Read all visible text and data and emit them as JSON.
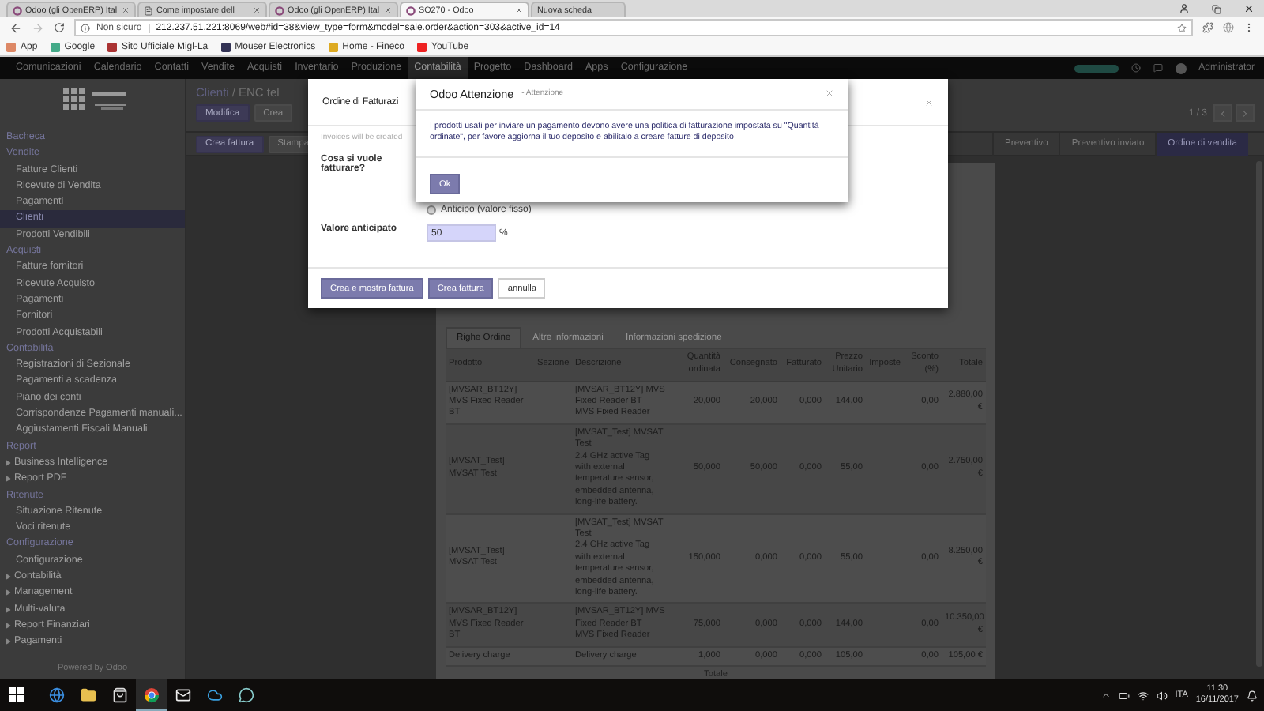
{
  "browser": {
    "tabs": [
      {
        "title": "Odoo (gli OpenERP) Ital",
        "kind": "site",
        "selected": false
      },
      {
        "title": "Come impostare dell",
        "kind": "document",
        "selected": false
      },
      {
        "title": "Odoo (gli OpenERP) Ital",
        "kind": "site",
        "selected": false
      },
      {
        "title": "SO270 - Odoo",
        "kind": "site",
        "selected": true
      },
      {
        "title": "Nuova scheda",
        "kind": "blank",
        "selected": false
      }
    ],
    "security": "Non sicuro",
    "url": "212.237.51.221:8069/web#id=38&view_type=form&model=sale.order&action=303&active_id=14",
    "bookmarks": [
      "App",
      "Google",
      "Sito Ufficiale Migl-La",
      "Mouser Electronics",
      "Home - Fineco",
      "YouTube"
    ]
  },
  "top_nav": {
    "items": [
      {
        "label": "Comunicazioni",
        "selected": false
      },
      {
        "label": "Calendario",
        "selected": false
      },
      {
        "label": "Contatti",
        "selected": false
      },
      {
        "label": "Vendite",
        "selected": false
      },
      {
        "label": "Acquisti",
        "selected": false
      },
      {
        "label": "Inventario",
        "selected": false
      },
      {
        "label": "Produzione",
        "selected": false
      },
      {
        "label": "Contabilità",
        "selected": true
      },
      {
        "label": "Progetto",
        "selected": false
      },
      {
        "label": "Dashboard",
        "selected": false
      },
      {
        "label": "Apps",
        "selected": false
      },
      {
        "label": "Configurazione",
        "selected": false
      }
    ],
    "user": "Administrator"
  },
  "sidebar": {
    "items": [
      {
        "label": "Bacheca",
        "kind": "header",
        "selected": false
      },
      {
        "label": "Vendite",
        "kind": "header",
        "selected": false
      },
      {
        "label": "Fatture Clienti",
        "kind": "link",
        "selected": false
      },
      {
        "label": "Ricevute di Vendita",
        "kind": "link",
        "selected": false
      },
      {
        "label": "Pagamenti",
        "kind": "link",
        "selected": false
      },
      {
        "label": "Clienti",
        "kind": "link",
        "selected": true
      },
      {
        "label": "Prodotti Vendibili",
        "kind": "link",
        "selected": false
      },
      {
        "label": "Acquisti",
        "kind": "header",
        "selected": false
      },
      {
        "label": "Fatture fornitori",
        "kind": "link",
        "selected": false
      },
      {
        "label": "Ricevute Acquisto",
        "kind": "link",
        "selected": false
      },
      {
        "label": "Pagamenti",
        "kind": "link",
        "selected": false
      },
      {
        "label": "Fornitori",
        "kind": "link",
        "selected": false
      },
      {
        "label": "Prodotti Acquistabili",
        "kind": "link",
        "selected": false
      },
      {
        "label": "Contabilità",
        "kind": "header",
        "selected": false
      },
      {
        "label": "Registrazioni di Sezionale",
        "kind": "link",
        "selected": false
      },
      {
        "label": "Pagamenti a scadenza",
        "kind": "link",
        "selected": false
      },
      {
        "label": "Piano dei conti",
        "kind": "link",
        "selected": false
      },
      {
        "label": "Corrispondenze Pagamenti manuali...",
        "kind": "link",
        "selected": false
      },
      {
        "label": "Aggiustamenti Fiscali Manuali",
        "kind": "link",
        "selected": false
      },
      {
        "label": "Report",
        "kind": "header",
        "selected": false
      },
      {
        "label": "Business Intelligence",
        "kind": "folder",
        "selected": false
      },
      {
        "label": "Report PDF",
        "kind": "folder",
        "selected": false
      },
      {
        "label": "Ritenute",
        "kind": "header",
        "selected": false
      },
      {
        "label": "Situazione Ritenute",
        "kind": "link",
        "selected": false
      },
      {
        "label": "Voci ritenute",
        "kind": "link",
        "selected": false
      },
      {
        "label": "Configurazione",
        "kind": "header",
        "selected": false
      },
      {
        "label": "Configurazione",
        "kind": "link",
        "selected": false
      },
      {
        "label": "Contabilità",
        "kind": "folder",
        "selected": false
      },
      {
        "label": "Management",
        "kind": "folder",
        "selected": false
      },
      {
        "label": "Multi-valuta",
        "kind": "folder",
        "selected": false
      },
      {
        "label": "Report Finanziari",
        "kind": "folder",
        "selected": false
      },
      {
        "label": "Pagamenti",
        "kind": "folder",
        "selected": false
      }
    ],
    "footer": "Powered by Odoo"
  },
  "breadcrumb": {
    "items": [
      "Clienti",
      "ENC tel"
    ],
    "separator": "/"
  },
  "actions": [
    "Modifica",
    "Crea"
  ],
  "pager": "1 / 3",
  "header_buttons": [
    "Crea fattura",
    "Stampa"
  ],
  "stages": [
    {
      "label": "Preventivo",
      "selected": false
    },
    {
      "label": "Preventivo inviato",
      "selected": false
    },
    {
      "label": "Ordine di vendita",
      "selected": true
    }
  ],
  "notebook": {
    "tabs": [
      {
        "label": "Righe Ordine",
        "selected": true
      },
      {
        "label": "Altre informazioni",
        "selected": false
      },
      {
        "label": "Informazioni spedizione",
        "selected": false
      }
    ],
    "columns": [
      "Prodotto",
      "Sezione",
      "Descrizione",
      "Quantità ordinata",
      "Consegnato",
      "Fatturato",
      "Prezzo Unitario",
      "Imposte",
      "Sconto (%)",
      "Totale"
    ],
    "rows": [
      {
        "product": "[MVSAR_BT12Y] MVS Fixed Reader BT",
        "description": "[MVSAR_BT12Y] MVS Fixed Reader BT\nMVS Fixed Reader",
        "ordered": "20,000",
        "delivered": "20,000",
        "invoiced": "0,000",
        "price": "144,00",
        "discount": "0,00",
        "total": "2.880,00 €"
      },
      {
        "product": "[MVSAT_Test] MVSAT Test",
        "description": "[MVSAT_Test] MVSAT Test\n2.4 GHz active Tag with external temperature sensor, embedded antenna, long-life battery.",
        "ordered": "50,000",
        "delivered": "50,000",
        "invoiced": "0,000",
        "price": "55,00",
        "discount": "0,00",
        "total": "2.750,00 €"
      },
      {
        "product": "[MVSAT_Test] MVSAT Test",
        "description": "[MVSAT_Test] MVSAT Test\n2.4 GHz active Tag with external temperature sensor, embedded antenna, long-life battery.",
        "ordered": "150,000",
        "delivered": "0,000",
        "invoiced": "0,000",
        "price": "55,00",
        "discount": "0,00",
        "total": "8.250,00 €"
      },
      {
        "product": "[MVSAR_BT12Y] MVS Fixed Reader BT",
        "description": "[MVSAR_BT12Y] MVS Fixed Reader BT\nMVS Fixed Reader",
        "ordered": "75,000",
        "delivered": "0,000",
        "invoiced": "0,000",
        "price": "144,00",
        "discount": "0,00",
        "total": "10.350,00 €"
      },
      {
        "product": "Delivery charge",
        "description": "Delivery charge",
        "ordered": "1,000",
        "delivered": "0,000",
        "invoiced": "0,000",
        "price": "105,00",
        "discount": "0,00",
        "total": "105,00 €"
      }
    ],
    "footer": "Totale"
  },
  "invoice_dialog": {
    "title": "Ordine di Fatturazi",
    "hint": "Invoices will be created",
    "question": "Cosa si vuole fatturare?",
    "options": [
      {
        "label": "Anticipo (valore fisso)",
        "selected": false
      }
    ],
    "amount_label": "Valore anticipato",
    "amount": "50",
    "unit": "%",
    "buttons": [
      "Crea e mostra fattura",
      "Crea fattura",
      "annulla"
    ]
  },
  "warning_dialog": {
    "title": "Odoo Attenzione",
    "subtitle": "- Attenzione",
    "message": "I prodotti usati per inviare un pagamento devono avere una politica di fatturazione impostata su \"Quantità ordinate\", per favore aggiorna il tuo deposito e abilitalo a creare fatture di deposito",
    "button": "Ok"
  },
  "taskbar": {
    "language": "ITA",
    "time": "11:30",
    "date": "16/11/2017"
  }
}
